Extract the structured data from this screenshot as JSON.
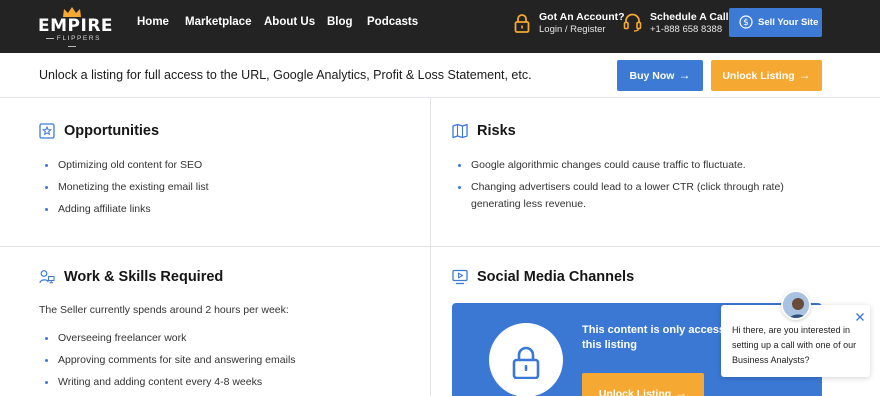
{
  "brand": {
    "name": "EMPIRE",
    "tagline": "FLIPPERS",
    "accent": "#f5a832",
    "primary": "#3d7ad6"
  },
  "nav": {
    "links": [
      "Home",
      "Marketplace",
      "About Us",
      "Blog",
      "Podcasts"
    ],
    "account": {
      "title": "Got An Account?",
      "sub": "Login / Register",
      "icon": "lock-icon"
    },
    "call": {
      "title": "Schedule A Call",
      "sub": "+1-888 658 8388",
      "icon": "headset-icon"
    },
    "sell_label": "Sell Your Site"
  },
  "unlock_bar": {
    "text": "Unlock a listing for full access to the URL, Google Analytics, Profit & Loss Statement, etc.",
    "buy_label": "Buy Now",
    "unlock_label": "Unlock Listing"
  },
  "opportunities": {
    "title": "Opportunities",
    "items": [
      "Optimizing old content for SEO",
      "Monetizing the existing email list",
      "Adding affiliate links"
    ]
  },
  "risks": {
    "title": "Risks",
    "items": [
      "Google algorithmic changes could cause traffic to fluctuate.",
      "Changing advertisers could lead to a lower CTR (click through rate) generating less revenue."
    ]
  },
  "work": {
    "title": "Work & Skills Required",
    "intro": "The Seller currently spends around 2 hours per week:",
    "items": [
      "Overseeing freelancer work",
      "Approving comments for site and answering emails",
      "Writing and adding content every 4-8 weeks"
    ]
  },
  "social": {
    "title": "Social Media Channels",
    "locked_text": "This content is only accessible with this listing",
    "unlock_label": "Unlock Listing"
  },
  "chat": {
    "message": "Hi there, are you interested in setting up a call with one of our Business Analysts?"
  }
}
